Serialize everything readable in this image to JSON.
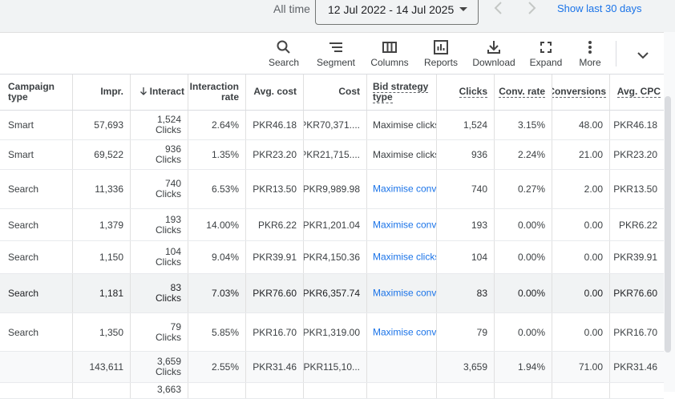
{
  "datebar": {
    "label": "All time",
    "range": "12 Jul 2022 - 14 Jul 2025",
    "show_last": "Show last 30 days"
  },
  "toolbar": {
    "items": [
      {
        "label": "Search",
        "icon": "search-icon"
      },
      {
        "label": "Segment",
        "icon": "segment-icon"
      },
      {
        "label": "Columns",
        "icon": "columns-icon"
      },
      {
        "label": "Reports",
        "icon": "reports-icon"
      },
      {
        "label": "Download",
        "icon": "download-icon"
      },
      {
        "label": "Expand",
        "icon": "expand-icon"
      },
      {
        "label": "More",
        "icon": "more-icon"
      }
    ]
  },
  "table": {
    "headers": {
      "campaign_type_1": "Campaign",
      "campaign_type_2": "type",
      "impr": "Impr.",
      "interactions": "Interact",
      "interaction_rate_1": "Interaction",
      "interaction_rate_2": "rate",
      "avg_cost": "Avg. cost",
      "cost": "Cost",
      "bid_1": "Bid strategy",
      "bid_2": "type",
      "clicks": "Clicks",
      "conv_rate": "Conv. rate",
      "conversions": "Conversions",
      "avg_cpc": "Avg. CPC"
    },
    "rows": [
      {
        "type": "Smart",
        "impr": "57,693",
        "inter_num": "1,524",
        "inter_unit": "Clicks",
        "rate": "2.64%",
        "avg_cost": "PKR46.18",
        "cost": "PKR70,371....",
        "bid": "Maximise clicks",
        "bid_link": false,
        "clicks": "1,524",
        "conv_rate": "3.15%",
        "conversions": "48.00",
        "avg_cpc": "PKR46.18"
      },
      {
        "type": "Smart",
        "impr": "69,522",
        "inter_num": "936",
        "inter_unit": "Clicks",
        "rate": "1.35%",
        "avg_cost": "PKR23.20",
        "cost": "PKR21,715....",
        "bid": "Maximise clicks",
        "bid_link": false,
        "clicks": "936",
        "conv_rate": "2.24%",
        "conversions": "21.00",
        "avg_cpc": "PKR23.20"
      },
      {
        "type": "Search",
        "impr": "11,336",
        "inter_num": "740",
        "inter_unit": "Clicks",
        "rate": "6.53%",
        "avg_cost": "PKR13.50",
        "cost": "PKR9,989.98",
        "bid": "Maximise conversions",
        "bid_link": true,
        "clicks": "740",
        "conv_rate": "0.27%",
        "conversions": "2.00",
        "avg_cpc": "PKR13.50"
      },
      {
        "type": "Search",
        "impr": "1,379",
        "inter_num": "193",
        "inter_unit": "Clicks",
        "rate": "14.00%",
        "avg_cost": "PKR6.22",
        "cost": "PKR1,201.04",
        "bid": "Maximise conversions",
        "bid_link": true,
        "clicks": "193",
        "conv_rate": "0.00%",
        "conversions": "0.00",
        "avg_cpc": "PKR6.22"
      },
      {
        "type": "Search",
        "impr": "1,150",
        "inter_num": "104",
        "inter_unit": "Clicks",
        "rate": "9.04%",
        "avg_cost": "PKR39.91",
        "cost": "PKR4,150.36",
        "bid": "Maximise clicks",
        "bid_link": true,
        "clicks": "104",
        "conv_rate": "0.00%",
        "conversions": "0.00",
        "avg_cpc": "PKR39.91"
      },
      {
        "type": "Search",
        "impr": "1,181",
        "inter_num": "83",
        "inter_unit": "Clicks",
        "rate": "7.03%",
        "avg_cost": "PKR76.60",
        "cost": "PKR6,357.74",
        "bid": "Maximise conversions",
        "bid_link": true,
        "clicks": "83",
        "conv_rate": "0.00%",
        "conversions": "0.00",
        "avg_cpc": "PKR76.60"
      },
      {
        "type": "Search",
        "impr": "1,350",
        "inter_num": "79",
        "inter_unit": "Clicks",
        "rate": "5.85%",
        "avg_cost": "PKR16.70",
        "cost": "PKR1,319.00",
        "bid": "Maximise conversions",
        "bid_link": true,
        "clicks": "79",
        "conv_rate": "0.00%",
        "conversions": "0.00",
        "avg_cpc": "PKR16.70"
      }
    ],
    "total": {
      "impr": "143,611",
      "inter_num": "3,659",
      "inter_unit": "Clicks",
      "rate": "2.55%",
      "avg_cost": "PKR31.46",
      "cost": "PKR115,10...",
      "clicks": "3,659",
      "conv_rate": "1.94%",
      "conversions": "71.00",
      "avg_cpc": "PKR31.46"
    },
    "partial": {
      "inter_num": "3,663"
    }
  },
  "colors": {
    "link": "#1a73e8",
    "highlight": "#f1f3f4",
    "text": "#3c4043"
  }
}
